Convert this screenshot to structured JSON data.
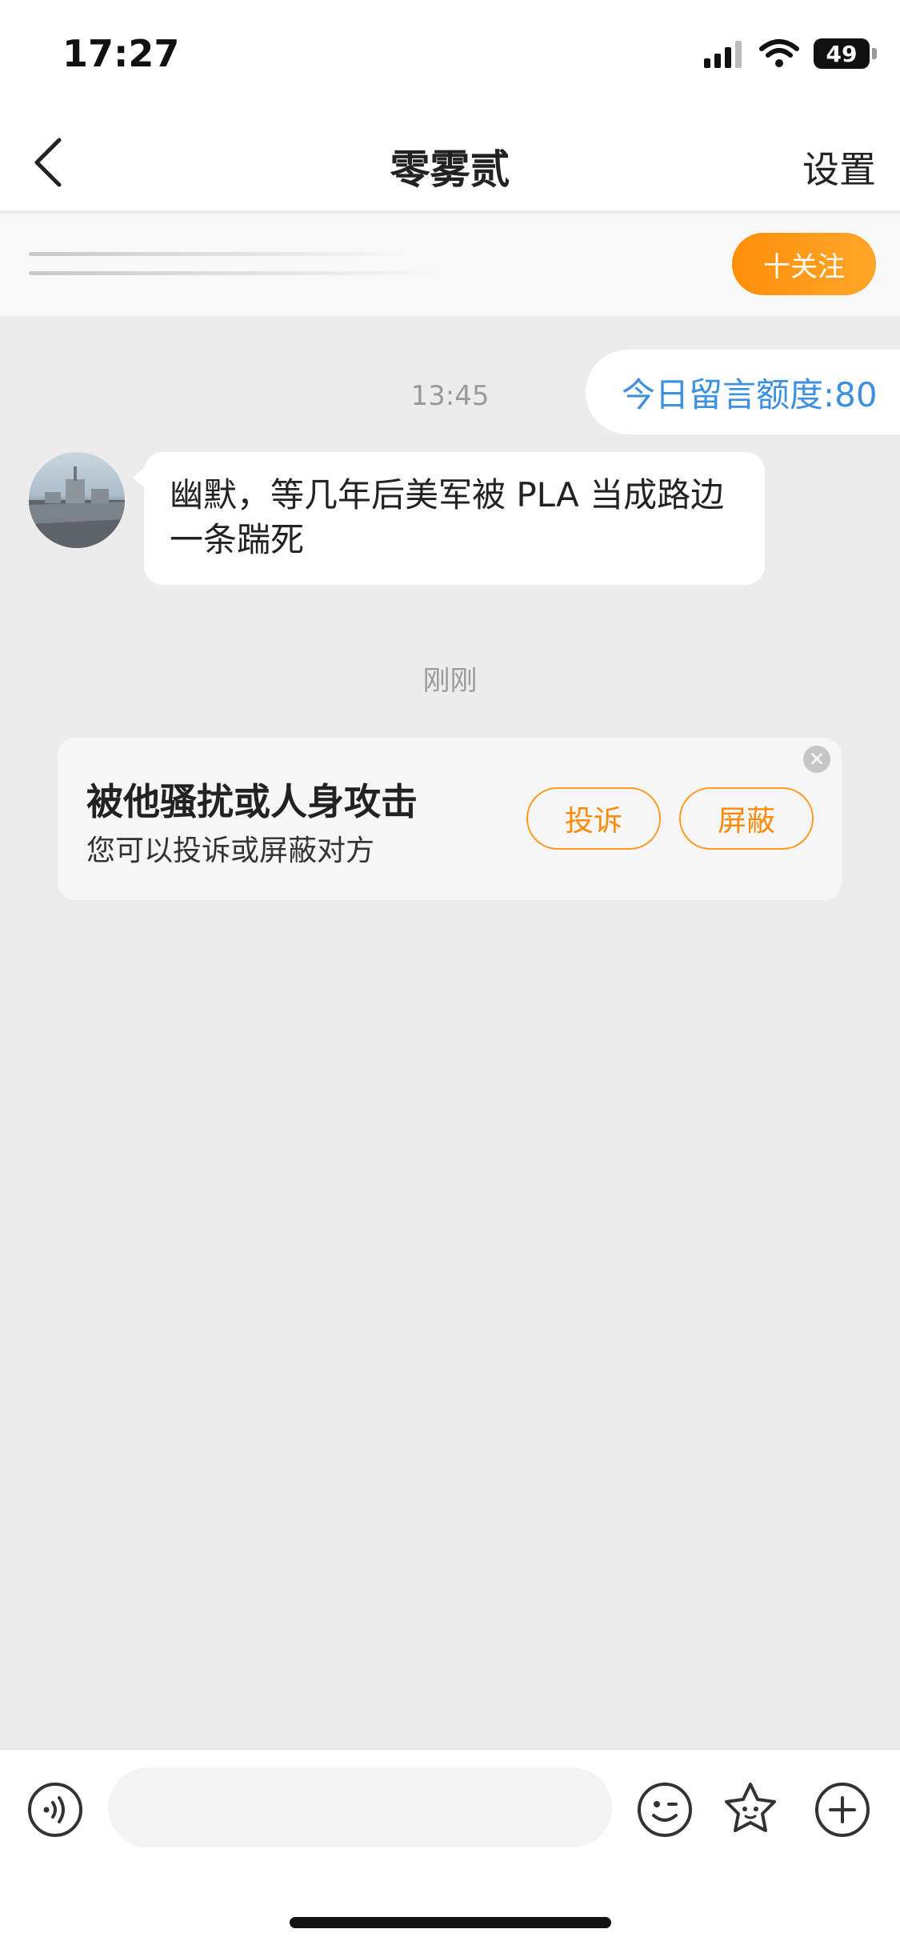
{
  "status_bar": {
    "time": "17:27",
    "battery": "49"
  },
  "nav": {
    "title": "零雾贰",
    "settings_label": "设置"
  },
  "follow": {
    "label": "十关注"
  },
  "chat": {
    "quota": "今日留言额度:80",
    "timestamp1": "13:45",
    "message": "幽默，等几年后美军被 PLA 当成路边一条踹死",
    "timestamp2": "刚刚"
  },
  "report_card": {
    "title": "被他骚扰或人身攻击",
    "subtitle": "您可以投诉或屏蔽对方",
    "report_label": "投诉",
    "block_label": "屏蔽"
  },
  "input": {
    "placeholder": ""
  },
  "icons": [
    "back-chevron",
    "voice",
    "emoji",
    "sticker",
    "plus",
    "close",
    "signal",
    "wifi",
    "battery"
  ],
  "colors": {
    "accent": "#ff8f0a",
    "quota_blue": "#3d8fe0",
    "background": "#ececec"
  }
}
